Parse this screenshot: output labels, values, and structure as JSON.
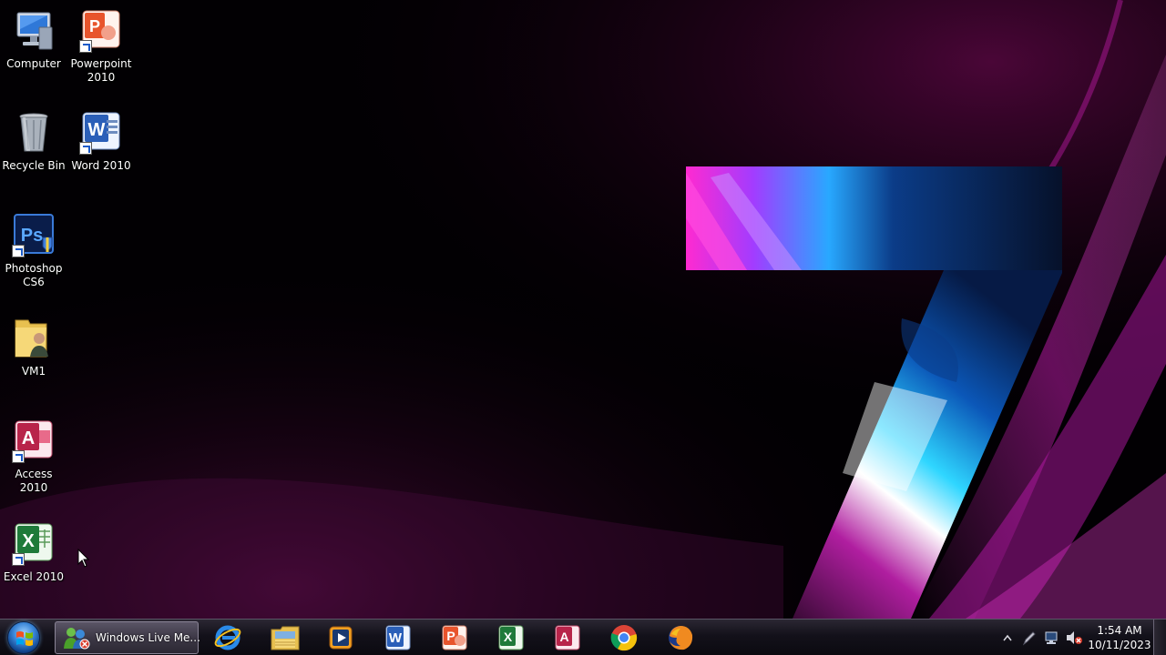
{
  "desktop": {
    "icons": [
      {
        "id": "computer",
        "label": "Computer",
        "icon": "computer-icon"
      },
      {
        "id": "powerpoint",
        "label": "Powerpoint\n2010",
        "icon": "powerpoint-icon"
      },
      {
        "id": "recycle",
        "label": "Recycle Bin",
        "icon": "recycle-bin-icon"
      },
      {
        "id": "word",
        "label": "Word 2010",
        "icon": "word-icon"
      },
      {
        "id": "photoshop",
        "label": "Photoshop\nCS6",
        "icon": "photoshop-icon"
      },
      {
        "id": "vm1",
        "label": "VM1",
        "icon": "user-folder-icon"
      },
      {
        "id": "access",
        "label": "Access 2010",
        "icon": "access-icon"
      },
      {
        "id": "excel",
        "label": "Excel 2010",
        "icon": "excel-icon"
      }
    ]
  },
  "taskbar": {
    "start": {
      "icon": "windows-start-orb"
    },
    "active_window": {
      "label": "Windows Live Me...",
      "icon": "windows-live-messenger-icon"
    },
    "pinned": [
      {
        "name": "internet-explorer",
        "icon": "internet-explorer-icon"
      },
      {
        "name": "windows-explorer",
        "icon": "folder-library-icon"
      },
      {
        "name": "media-player",
        "icon": "media-player-icon"
      },
      {
        "name": "word",
        "icon": "word-icon"
      },
      {
        "name": "powerpoint",
        "icon": "powerpoint-icon"
      },
      {
        "name": "excel",
        "icon": "excel-icon"
      },
      {
        "name": "access",
        "icon": "access-icon"
      },
      {
        "name": "chrome",
        "icon": "chrome-icon"
      },
      {
        "name": "firefox",
        "icon": "firefox-icon"
      }
    ],
    "tray": {
      "icons": [
        "show-hidden-icons-arrow",
        "pen-icon",
        "network-icon",
        "volume-muted-icon"
      ],
      "time": "1:54 AM",
      "date": "10/11/2023"
    }
  },
  "colors": {
    "accent_magenta": "#e020c8",
    "accent_cyan": "#2fd6ff",
    "taskbar_bg": "#13111a"
  }
}
